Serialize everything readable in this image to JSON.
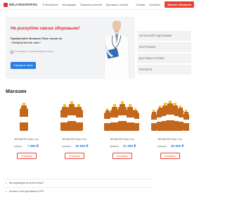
{
  "header": {
    "logo_text": "MELAXENSHOP.RU",
    "nav": [
      "О Мелаксене",
      "Инструкция",
      "Гарантии качества",
      "Доставка и оплата"
    ],
    "reviews_label": "Отзывы",
    "contacts_label": "Контакты",
    "order_label": "Заказать Мелаксен"
  },
  "hero": {
    "title": "Не рискуйте своим здоровьем!",
    "subtitle_start": "Приобретайте Мелаксен Плюс только на",
    "subtitle_highlight": "ОФИЦИАЛЬНОМ сайте!",
    "checkbox_label": "Я соглашаюсь с условиями обработки данных",
    "button_label": "Оформить заказ"
  },
  "sidebar": {
    "items": [
      "НЕ РИСКУЙТЕ ЗДОРОВЬЕМ",
      "ИНСТРУКЦИЯ",
      "ДОСТАВКА И ОПЛАТА",
      "КОНТАКТЫ"
    ]
  },
  "shop": {
    "title": "Магазин",
    "products": [
      {
        "name": "МЕЛАКСЕН Плюс 1 шт.",
        "old_price": "7 990 ₽",
        "new_price": "7 990 ₽",
        "button": "В корзину"
      },
      {
        "name": "МЕЛАКСЕН Плюс 3 шт.",
        "old_price": "23 970 ₽",
        "new_price": "16 990 ₽",
        "button": "В корзину"
      },
      {
        "name": "МЕЛАКСЕН Плюс 5 шт.",
        "old_price": "39 950 ₽",
        "new_price": "21 990 ₽",
        "button": "В корзину"
      },
      {
        "name": "МЕЛАКСЕН Плюс 7 шт.",
        "old_price": "55 930 ₽",
        "new_price": "26 990 ₽",
        "button": "В корзину"
      }
    ]
  },
  "faq": {
    "items": [
      "Как формируется цена на букс?",
      "Сколько стоит доставка по РФ?"
    ]
  },
  "colors": {
    "accent_red": "#e8412f",
    "accent_blue": "#2b7de0",
    "bottle_brown": "#c2671b"
  }
}
